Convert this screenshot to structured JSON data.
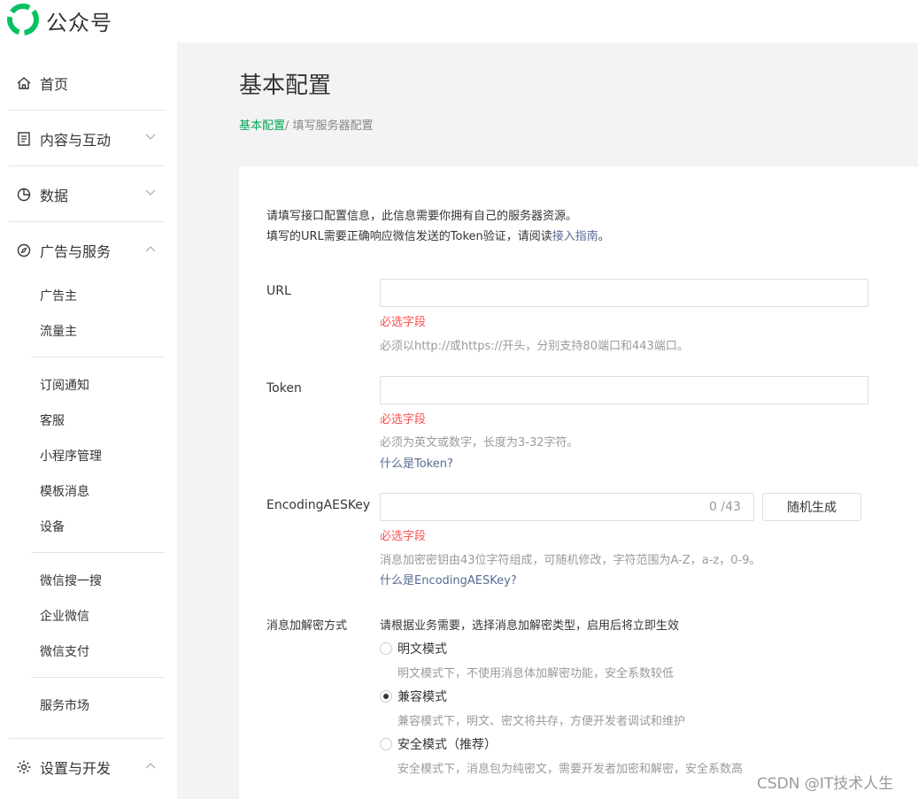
{
  "app": {
    "brand": "公众号"
  },
  "sidebar": {
    "items": [
      {
        "label": "首页",
        "icon": "home-icon"
      },
      {
        "label": "内容与互动",
        "icon": "document-icon",
        "expanded": false
      },
      {
        "label": "数据",
        "icon": "pie-chart-icon",
        "expanded": false
      },
      {
        "label": "广告与服务",
        "icon": "compass-icon",
        "expanded": true
      },
      {
        "label": "设置与开发",
        "icon": "gear-icon",
        "expanded": true
      }
    ],
    "ad_sub": [
      "广告主",
      "流量主"
    ],
    "service_sub": [
      "订阅通知",
      "客服",
      "小程序管理",
      "模板消息",
      "设备"
    ],
    "search_sub": [
      "微信搜一搜",
      "企业微信",
      "微信支付"
    ],
    "market_sub": [
      "服务市场"
    ]
  },
  "page": {
    "title": "基本配置",
    "breadcrumb": {
      "root": "基本配置",
      "sep_current": "/ 填写服务器配置"
    }
  },
  "form": {
    "intro_line1": "请填写接口配置信息，此信息需要你拥有自己的服务器资源。",
    "intro_line2_pre": "填写的URL需要正确响应微信发送的Token验证，请阅读",
    "intro_line2_link": "接入指南",
    "intro_line2_post": "。",
    "url": {
      "label": "URL",
      "value": "",
      "error": "必选字段",
      "hint": "必须以http://或https://开头，分别支持80端口和443端口。"
    },
    "token": {
      "label": "Token",
      "value": "",
      "error": "必选字段",
      "hint": "必须为英文或数字，长度为3-32字符。",
      "help": "什么是Token?"
    },
    "aeskey": {
      "label": "EncodingAESKey",
      "value": "",
      "counter": "0 /43",
      "generate_button": "随机生成",
      "error": "必选字段",
      "hint": "消息加密密钥由43位字符组成，可随机修改，字符范围为A-Z，a-z，0-9。",
      "help": "什么是EncodingAESKey?"
    },
    "encryption": {
      "label": "消息加解密方式",
      "description": "请根据业务需要，选择消息加解密类型，启用后将立即生效",
      "options": [
        {
          "label": "明文模式",
          "hint": "明文模式下，不使用消息体加解密功能，安全系数较低",
          "checked": false
        },
        {
          "label": "兼容模式",
          "hint": "兼容模式下，明文、密文将共存，方便开发者调试和维护",
          "checked": true
        },
        {
          "label": "安全模式（推荐）",
          "hint": "安全模式下，消息包为纯密文，需要开发者加密和解密，安全系数高",
          "checked": false
        }
      ]
    }
  },
  "watermark": "CSDN @IT技术人生",
  "colors": {
    "accent": "#07a65a",
    "link": "#576b95",
    "error": "#fa5151",
    "hint": "#9a9a9a"
  }
}
